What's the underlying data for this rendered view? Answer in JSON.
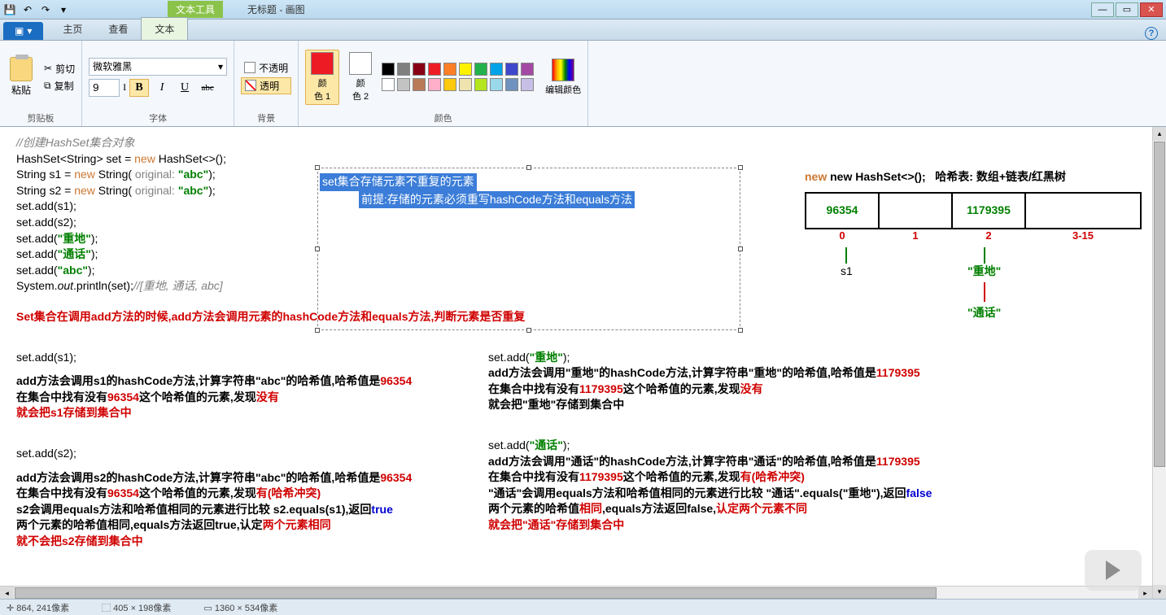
{
  "app": {
    "context_tab": "文本工具",
    "title": "无标题 - 画图"
  },
  "tabs": {
    "file": "▣",
    "home": "主页",
    "view": "查看",
    "text": "文本"
  },
  "ribbon": {
    "paste": "粘贴",
    "cut": "剪切",
    "copy": "复制",
    "clipboard_label": "剪贴板",
    "font_family": "微软雅黑",
    "font_size": "9",
    "font_label": "字体",
    "opaque": "不透明",
    "transparent": "透明",
    "bg_label": "背景",
    "color1": "颜\n色 1",
    "color2": "颜\n色 2",
    "edit_colors": "编辑颜色",
    "colors_label": "颜色"
  },
  "palette": {
    "row1": [
      "#000000",
      "#7f7f7f",
      "#880015",
      "#ed1c24",
      "#ff7f27",
      "#fff200",
      "#22b14c",
      "#00a2e8",
      "#3f48cc",
      "#a349a4"
    ],
    "row2": [
      "#ffffff",
      "#c3c3c3",
      "#b97a57",
      "#ffaec9",
      "#ffc90e",
      "#efe4b0",
      "#b5e61d",
      "#99d9ea",
      "#7092be",
      "#c8bfe7"
    ]
  },
  "code": {
    "c1": "//创建HashSet集合对象",
    "l1a": "HashSet<String> set = ",
    "l1b": "new",
    "l1c": " HashSet<>();",
    "l2a": "String s1 = ",
    "l2b": "new",
    "l2c": " String(",
    "l2d": " original: ",
    "l2e": "\"abc\"",
    "l2f": ");",
    "l3a": "String s2 = ",
    "l3b": "new",
    "l3c": " String(",
    "l3d": " original: ",
    "l3e": "\"abc\"",
    "l3f": ");",
    "l4": "set.add(s1);",
    "l5": "set.add(s2);",
    "l6a": "set.add(",
    "l6b": "\"重地\"",
    "l6c": ");",
    "l7a": "set.add(",
    "l7b": "\"通话\"",
    "l7c": ");",
    "l8a": "set.add(",
    "l8b": "\"abc\"",
    "l8c": ");",
    "l9a": "System.",
    "l9b": "out",
    "l9c": ".println(set);",
    "l9d": "//[重地, 通话, abc]"
  },
  "notes": {
    "main_red": "Set集合在调用add方法的时候,add方法会调用元素的hashCode方法和equals方法,判断元素是否重复",
    "box_line1": "set集合存储元素不重复的元素",
    "box_line2": "前提:存储的元素必须重写hashCode方法和equals方法",
    "hash_new": "new HashSet<>();",
    "hash_desc": "哈希表: 数组+链表/红黑树"
  },
  "hash": {
    "v0": "96354",
    "v2": "1179395",
    "i0": "0",
    "i1": "1",
    "i2": "2",
    "i3": "3-15",
    "s1": "s1",
    "n1": "\"重地\"",
    "n2": "\"通话\""
  },
  "left": {
    "h1": "set.add(s1);",
    "l1a": "add方法会调用s1的hashCode方法,计算字符串\"abc\"的哈希值,哈希值是",
    "l1b": "96354",
    "l2a": "在集合中找有没有",
    "l2b": "96354",
    "l2c": "这个哈希值的元素,发现",
    "l2d": "没有",
    "l3": "就会把s1存储到集合中",
    "h2": "set.add(s2);",
    "l4a": "add方法会调用s2的hashCode方法,计算字符串\"abc\"的哈希值,哈希值是",
    "l4b": "96354",
    "l5a": "在集合中找有没有",
    "l5b": "96354",
    "l5c": "这个哈希值的元素,发现",
    "l5d": "有(哈希冲突)",
    "l6a": "s2会调用equals方法和哈希值相同的元素进行比较 s2.equals(s1),返回",
    "l6b": "true",
    "l7a": "两个元素的哈希值相同,equals方法返回true,认定",
    "l7b": "两个元素相同",
    "l8": "就不会把s2存储到集合中"
  },
  "right": {
    "h1a": "set.add(",
    "h1b": "\"重地\"",
    "h1c": ");",
    "r1a": "add方法会调用\"重地\"的hashCode方法,计算字符串\"重地\"的哈希值,哈希值是",
    "r1b": "1179395",
    "r2a": "在集合中找有没有",
    "r2b": "1179395",
    "r2c": "这个哈希值的元素,发现",
    "r2d": "没有",
    "r3": "就会把\"重地\"存储到集合中",
    "h2a": "set.add(",
    "h2b": "\"通话\"",
    "h2c": ");",
    "r4a": "add方法会调用\"通话\"的hashCode方法,计算字符串\"通话\"的哈希值,哈希值是",
    "r4b": "1179395",
    "r5a": "在集合中找有没有",
    "r5b": "1179395",
    "r5c": "这个哈希值的元素,发现",
    "r5d": "有(哈希冲突)",
    "r6a": "\"通话\"会调用equals方法和哈希值相同的元素进行比较 \"通话\".equals(\"重地\"),返回",
    "r6b": "false",
    "r7a": "两个元素的哈希值",
    "r7b": "相同",
    "r7c": ",equals方法返回false,",
    "r7d": "认定两个元素不同",
    "r8": "就会把\"通话\"存储到集合中"
  },
  "status": {
    "pos": "864, 241像素",
    "sel": "405 × 198像素",
    "size": "1360 × 534像素"
  }
}
